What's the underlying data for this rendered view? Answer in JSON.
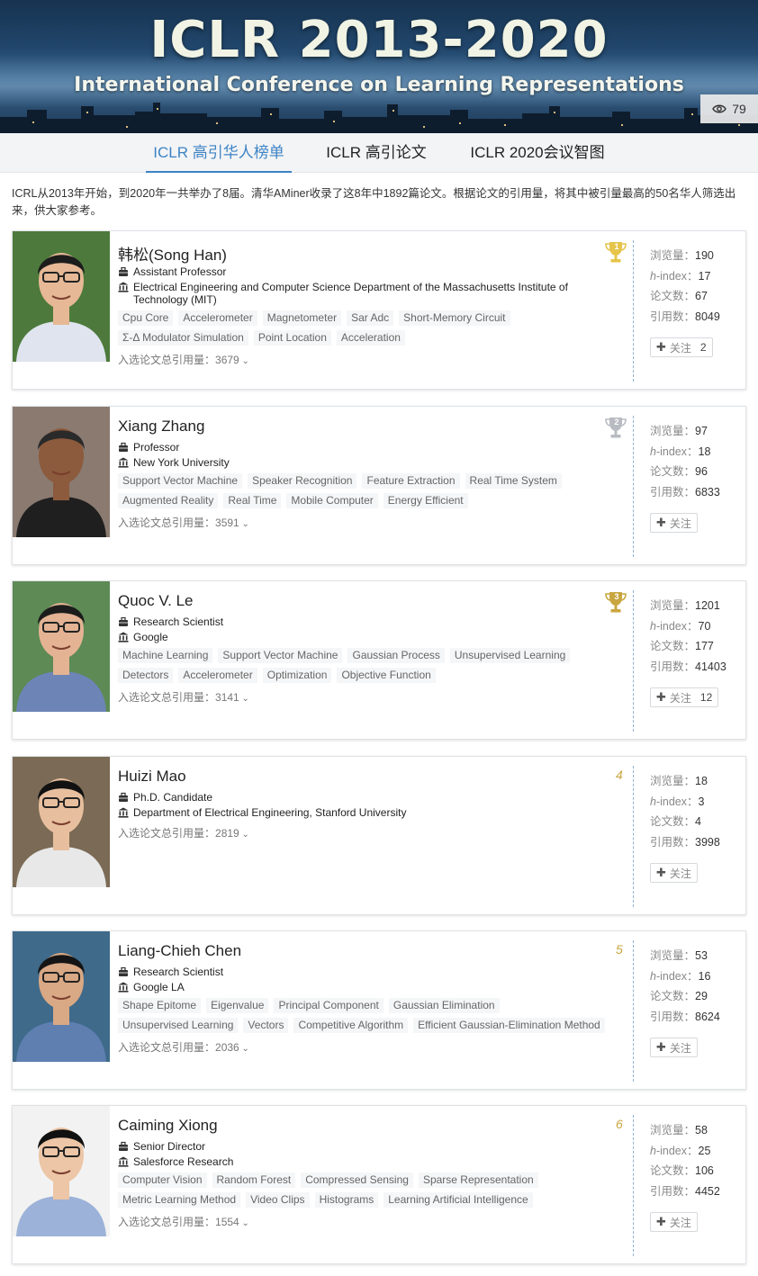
{
  "banner": {
    "title": "ICLR 2013-2020",
    "subtitle": "International Conference on Learning Representations",
    "views": "79",
    "views_icon": "eye-icon"
  },
  "tabs": [
    {
      "label": "ICLR 高引华人榜单",
      "active": true
    },
    {
      "label": "ICLR 高引论文",
      "active": false
    },
    {
      "label": "ICLR 2020会议智图",
      "active": false
    }
  ],
  "intro": "ICRL从2013年开始，到2020年一共举办了8届。清华AMiner收录了这8年中1892篇论文。根据论文的引用量，将其中被引量最高的50名华人筛选出来，供大家参考。",
  "labels": {
    "cite_total": "入选论文总引用量：",
    "views": "浏览量：",
    "hindex_h": "h",
    "hindex_rest": "-index：",
    "papers": "论文数：",
    "citations": "引用数：",
    "follow": "关注"
  },
  "colors": {
    "accent": "#3d83c4",
    "gold": "#e6c44a",
    "silver": "#b8bcc2",
    "bronze": "#c9a640"
  },
  "people": [
    {
      "rank": "1",
      "medal": "gold-trophy",
      "name": "韩松(Song Han)",
      "position": "Assistant Professor",
      "affiliation": "Electrical Engineering and Computer Science Department of the Massachusetts Institute of Technology (MIT)",
      "tags": [
        "Cpu Core",
        "Accelerometer",
        "Magnetometer",
        "Sar Adc",
        "Short-Memory Circuit",
        "Σ-Δ Modulator Simulation",
        "Point Location",
        "Acceleration"
      ],
      "cite_total": "3679",
      "views": "190",
      "hindex": "17",
      "papers": "67",
      "citations": "8049",
      "followers": "2"
    },
    {
      "rank": "2",
      "medal": "silver-trophy",
      "name": "Xiang Zhang",
      "position": "Professor",
      "affiliation": "New York University",
      "tags": [
        "Support Vector Machine",
        "Speaker Recognition",
        "Feature Extraction",
        "Real Time System",
        "Augmented Reality",
        "Real Time",
        "Mobile Computer",
        "Energy Efficient"
      ],
      "cite_total": "3591",
      "views": "97",
      "hindex": "18",
      "papers": "96",
      "citations": "6833",
      "followers": ""
    },
    {
      "rank": "3",
      "medal": "bronze-trophy",
      "name": "Quoc V. Le",
      "position": "Research Scientist",
      "affiliation": "Google",
      "tags": [
        "Machine Learning",
        "Support Vector Machine",
        "Gaussian Process",
        "Unsupervised Learning",
        "Detectors",
        "Accelerometer",
        "Optimization",
        "Objective Function"
      ],
      "cite_total": "3141",
      "views": "1201",
      "hindex": "70",
      "papers": "177",
      "citations": "41403",
      "followers": "12"
    },
    {
      "rank": "4",
      "medal": "",
      "name": "Huizi Mao",
      "position": "Ph.D. Candidate",
      "affiliation": "Department of Electrical Engineering, Stanford University",
      "tags": [],
      "cite_total": "2819",
      "views": "18",
      "hindex": "3",
      "papers": "4",
      "citations": "3998",
      "followers": ""
    },
    {
      "rank": "5",
      "medal": "",
      "name": "Liang-Chieh Chen",
      "position": "Research Scientist",
      "affiliation": "Google LA",
      "tags": [
        "Shape Epitome",
        "Eigenvalue",
        "Principal Component",
        "Gaussian Elimination",
        "Unsupervised Learning",
        "Vectors",
        "Competitive Algorithm",
        "Efficient Gaussian-Elimination Method"
      ],
      "cite_total": "2036",
      "views": "53",
      "hindex": "16",
      "papers": "29",
      "citations": "8624",
      "followers": ""
    },
    {
      "rank": "6",
      "medal": "",
      "name": "Caiming Xiong",
      "position": "Senior Director",
      "affiliation": "Salesforce Research",
      "tags": [
        "Computer Vision",
        "Random Forest",
        "Compressed Sensing",
        "Sparse Representation",
        "Metric Learning Method",
        "Video Clips",
        "Histograms",
        "Learning Artificial Intelligence"
      ],
      "cite_total": "1554",
      "views": "58",
      "hindex": "25",
      "papers": "106",
      "citations": "4452",
      "followers": ""
    }
  ]
}
